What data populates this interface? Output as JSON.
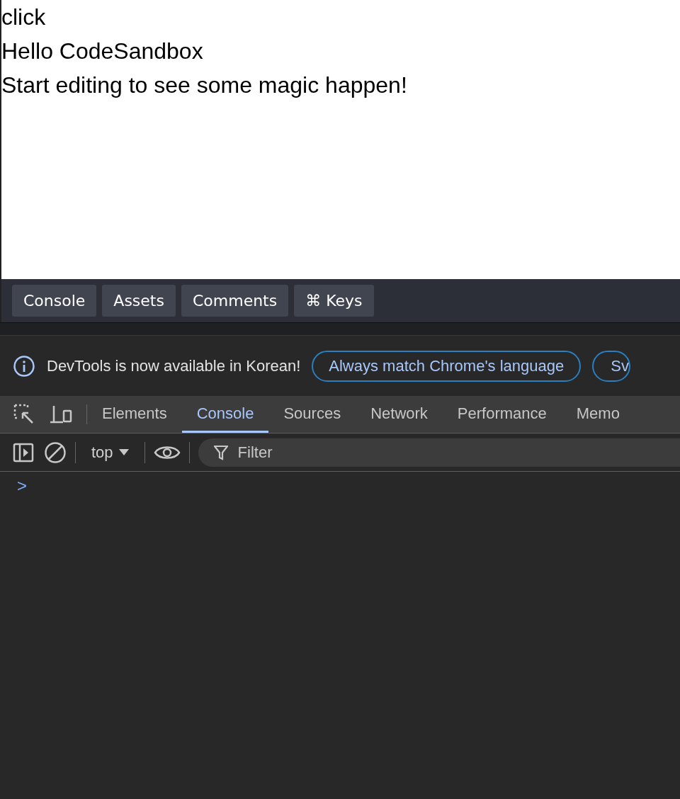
{
  "preview": {
    "lines": [
      "click",
      "Hello CodeSandbox",
      "Start editing to see some magic happen!"
    ]
  },
  "sandbox_tabs": [
    {
      "label": "Console"
    },
    {
      "label": "Assets"
    },
    {
      "label": "Comments"
    },
    {
      "label": "⌘ Keys"
    }
  ],
  "infobar": {
    "message": "DevTools is now available in Korean!",
    "buttons": [
      "Always match Chrome's language",
      "Sv"
    ]
  },
  "devtools_tabs": [
    {
      "label": "Elements",
      "selected": false
    },
    {
      "label": "Console",
      "selected": true
    },
    {
      "label": "Sources",
      "selected": false
    },
    {
      "label": "Network",
      "selected": false
    },
    {
      "label": "Performance",
      "selected": false
    },
    {
      "label": "Memo",
      "selected": false
    }
  ],
  "console_toolbar": {
    "context": "top",
    "filter": {
      "placeholder": "Filter"
    }
  },
  "console": {
    "prompt": ">"
  }
}
